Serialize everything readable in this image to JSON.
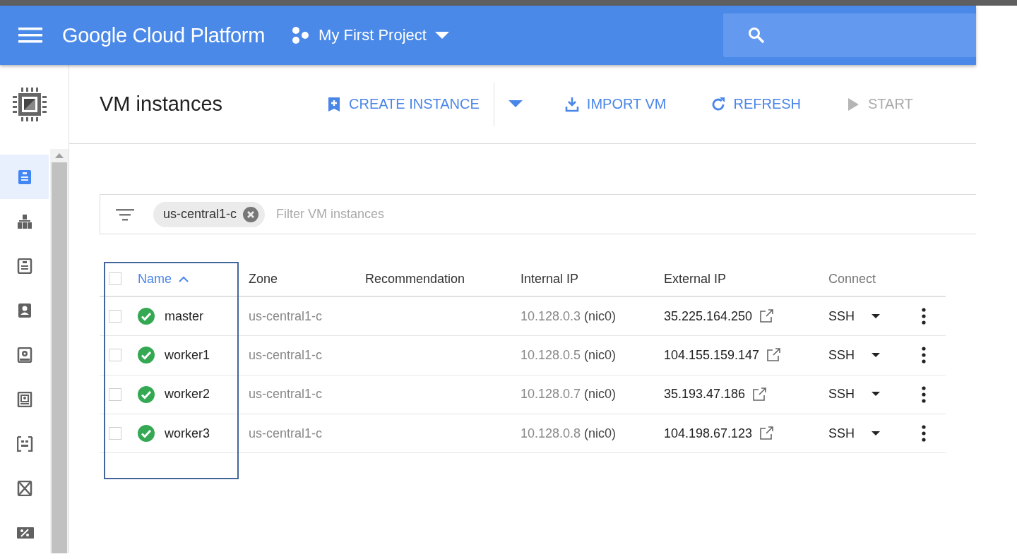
{
  "header": {
    "title": "Google Cloud Platform",
    "project": "My First Project"
  },
  "sidebar": {
    "items": [
      {
        "kind": "instances",
        "selected": true
      },
      {
        "kind": "groups",
        "selected": false
      },
      {
        "kind": "templates",
        "selected": false
      },
      {
        "kind": "tenancy",
        "selected": false
      },
      {
        "kind": "disks",
        "selected": false
      },
      {
        "kind": "snapshots",
        "selected": false
      },
      {
        "kind": "images",
        "selected": false
      },
      {
        "kind": "tpus",
        "selected": false
      },
      {
        "kind": "discounts",
        "selected": false
      }
    ]
  },
  "page": {
    "title": "VM instances"
  },
  "toolbar": [
    {
      "kind": "create",
      "label": "CREATE INSTANCE",
      "disabled": false
    },
    {
      "kind": "dropdown",
      "disabled": false
    },
    {
      "kind": "import",
      "label": "IMPORT VM",
      "disabled": false
    },
    {
      "kind": "refresh",
      "label": "REFRESH",
      "disabled": false
    },
    {
      "kind": "start",
      "label": "START",
      "disabled": true
    }
  ],
  "filter": {
    "chips": [
      "us-central1-c"
    ],
    "placeholder": "Filter VM instances"
  },
  "table": {
    "select_all": {
      "checked": false
    },
    "columns": [
      {
        "label": "Name",
        "sorted": true
      },
      {
        "label": "Zone",
        "sorted": false
      },
      {
        "label": "Recommendation",
        "sorted": false
      },
      {
        "label": "Internal IP",
        "sorted": false
      },
      {
        "label": "External IP",
        "sorted": false
      },
      {
        "label": "Connect",
        "sorted": false
      }
    ],
    "rows": [
      {
        "checked": false,
        "running": true,
        "name": "master",
        "zone": "us-central1-c",
        "internal_ip": "10.128.0.3",
        "nic": "(nic0)",
        "external_ip": "35.225.164.250",
        "connect": "SSH"
      },
      {
        "checked": false,
        "running": true,
        "name": "worker1",
        "zone": "us-central1-c",
        "internal_ip": "10.128.0.5",
        "nic": "(nic0)",
        "external_ip": "104.155.159.147",
        "connect": "SSH"
      },
      {
        "checked": false,
        "running": true,
        "name": "worker2",
        "zone": "us-central1-c",
        "internal_ip": "10.128.0.7",
        "nic": "(nic0)",
        "external_ip": "35.193.47.186",
        "connect": "SSH"
      },
      {
        "checked": false,
        "running": true,
        "name": "worker3",
        "zone": "us-central1-c",
        "internal_ip": "10.128.0.8",
        "nic": "(nic0)",
        "external_ip": "104.198.67.123",
        "connect": "SSH"
      }
    ]
  }
}
